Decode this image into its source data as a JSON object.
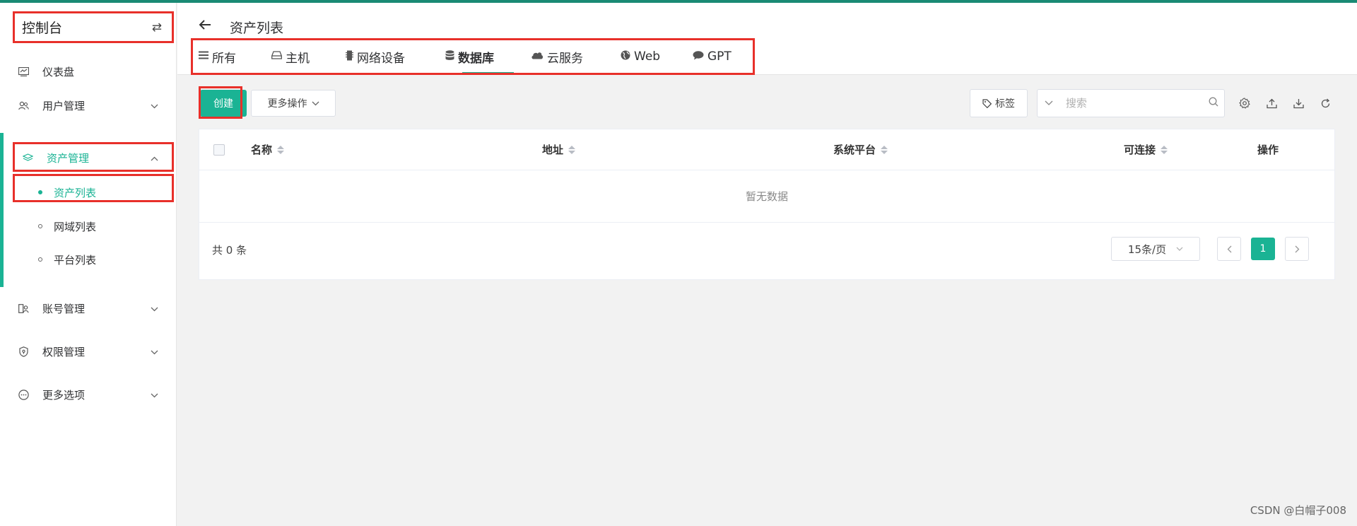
{
  "sidebar": {
    "console_title": "控制台",
    "items": [
      {
        "label": "仪表盘"
      },
      {
        "label": "用户管理"
      },
      {
        "label": "资产管理"
      },
      {
        "label": "账号管理"
      },
      {
        "label": "权限管理"
      },
      {
        "label": "更多选项"
      }
    ],
    "sub_items": [
      {
        "label": "资产列表"
      },
      {
        "label": "网域列表"
      },
      {
        "label": "平台列表"
      }
    ]
  },
  "header": {
    "title": "资产列表",
    "tabs": [
      {
        "label": "所有",
        "icon": "list-icon"
      },
      {
        "label": "主机",
        "icon": "host-icon"
      },
      {
        "label": "网络设备",
        "icon": "network-device-icon"
      },
      {
        "label": "数据库",
        "icon": "database-icon"
      },
      {
        "label": "云服务",
        "icon": "cloud-icon"
      },
      {
        "label": "Web",
        "icon": "globe-icon"
      },
      {
        "label": "GPT",
        "icon": "chat-icon"
      }
    ],
    "active_tab": "数据库"
  },
  "toolbar": {
    "create_label": "创建",
    "more_label": "更多操作",
    "tag_label": "标签",
    "search_placeholder": "搜索"
  },
  "table": {
    "columns": [
      "名称",
      "地址",
      "系统平台",
      "可连接",
      "操作"
    ],
    "empty_text": "暂无数据",
    "total_text": "共 0 条",
    "page_size": "15条/页",
    "current_page": "1"
  },
  "watermark": "CSDN @白帽子008",
  "colors": {
    "accent": "#1ab394",
    "top_bar": "#1a8a74",
    "highlight_box": "#e8302a"
  }
}
